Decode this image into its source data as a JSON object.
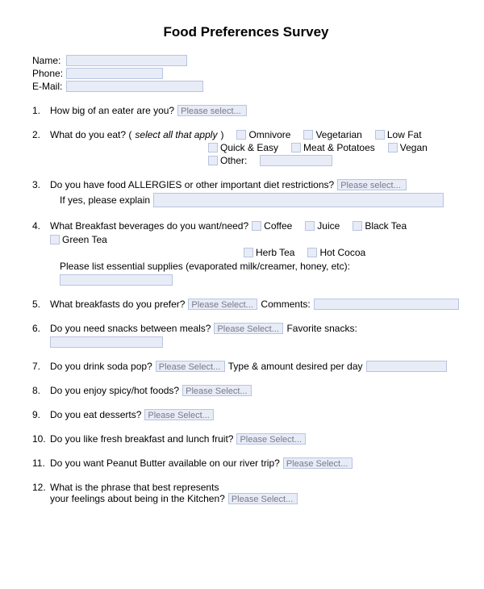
{
  "title": "Food Preferences Survey",
  "contact": {
    "name_label": "Name:",
    "phone_label": "Phone:",
    "email_label": "E-Mail:"
  },
  "placeholder": {
    "select": "Please select...",
    "select2": "Please Select..."
  },
  "q1": {
    "num": "1.",
    "text": "How big of an eater are you?"
  },
  "q2": {
    "num": "2.",
    "text_a": "What do you eat? (",
    "text_b": "select all that apply",
    "text_c": ")",
    "opts": {
      "omnivore": "Omnivore",
      "vegetarian": "Vegetarian",
      "lowfat": "Low Fat",
      "quick": "Quick & Easy",
      "meat": "Meat & Potatoes",
      "vegan": "Vegan",
      "other": "Other:"
    }
  },
  "q3": {
    "num": "3.",
    "text": "Do you have food ALLERGIES or other important diet restrictions?",
    "sub": "If yes, please explain"
  },
  "q4": {
    "num": "4.",
    "text": "What Breakfast beverages do you want/need?",
    "opts": {
      "coffee": "Coffee",
      "juice": "Juice",
      "blacktea": "Black Tea",
      "greentea": "Green Tea",
      "herbtea": "Herb Tea",
      "cocoa": "Hot Cocoa"
    },
    "sub": "Please list essential supplies (evaporated milk/creamer, honey, etc):"
  },
  "q5": {
    "num": "5.",
    "text": "What breakfasts do you prefer?",
    "sub": "Comments:"
  },
  "q6": {
    "num": "6.",
    "text": "Do you need snacks between meals?",
    "sub": "Favorite snacks:"
  },
  "q7": {
    "num": "7.",
    "text": "Do you drink soda pop?",
    "sub": "Type & amount desired per day"
  },
  "q8": {
    "num": "8.",
    "text": "Do you enjoy spicy/hot foods?"
  },
  "q9": {
    "num": "9.",
    "text": "Do you eat desserts?"
  },
  "q10": {
    "num": "10.",
    "text": "Do you like fresh breakfast and lunch fruit?"
  },
  "q11": {
    "num": "11.",
    "text": "Do you want Peanut Butter available on our river trip?"
  },
  "q12": {
    "num": "12.",
    "text_a": "What is the phrase that best represents",
    "text_b": "your feelings about being in the Kitchen?"
  }
}
